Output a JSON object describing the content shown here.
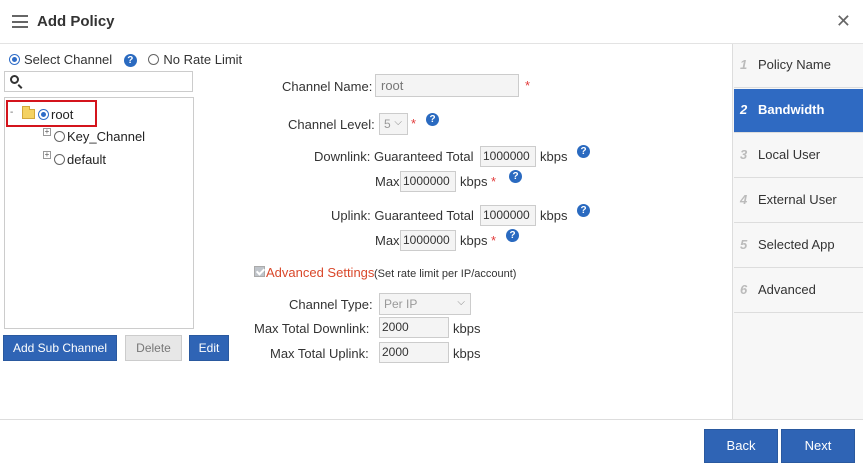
{
  "header": {
    "title": "Add Policy",
    "close": "✕"
  },
  "channel_mode": {
    "select_channel": "Select Channel",
    "help": "?",
    "no_rate_limit": "No Rate Limit"
  },
  "search": {
    "value": ""
  },
  "tree": {
    "toggle": "-",
    "root": "root",
    "children": [
      {
        "label": "Key_Channel"
      },
      {
        "label": "default"
      }
    ]
  },
  "tree_buttons": {
    "add": "Add Sub Channel",
    "delete": "Delete",
    "edit": "Edit"
  },
  "form": {
    "channel_name_label": "Channel Name:",
    "channel_name_value": "root",
    "channel_level_label": "Channel Level:",
    "channel_level_value": "5",
    "star": "*",
    "help": "?",
    "downlink_label": "Downlink: Guaranteed Total",
    "downlink_guaranteed": "1000000",
    "max_label": "Max",
    "downlink_max": "1000000",
    "uplink_label": "Uplink: Guaranteed Total",
    "uplink_guaranteed": "1000000",
    "uplink_max": "1000000",
    "unit": "kbps"
  },
  "advanced": {
    "label": "Advanced Settings",
    "hint": "(Set rate limit per IP/account)",
    "channel_type_label": "Channel Type:",
    "channel_type_value": "Per IP",
    "max_downlink_label": "Max Total Downlink:",
    "max_downlink_value": "2000",
    "max_uplink_label": "Max Total Uplink:",
    "max_uplink_value": "2000",
    "unit": "kbps"
  },
  "steps": [
    {
      "num": "1",
      "label": "Policy Name"
    },
    {
      "num": "2",
      "label": "Bandwidth"
    },
    {
      "num": "3",
      "label": "Local User"
    },
    {
      "num": "4",
      "label": "External User"
    },
    {
      "num": "5",
      "label": "Selected App"
    },
    {
      "num": "6",
      "label": "Advanced"
    }
  ],
  "footer": {
    "back": "Back",
    "next": "Next"
  },
  "colors": {
    "accent": "#2f64b5",
    "required": "#e23a3a",
    "advanced": "#d9482b",
    "highlight": "#d4141c"
  }
}
